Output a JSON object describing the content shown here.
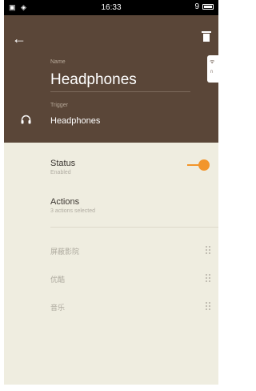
{
  "status_bar": {
    "left_icons": "▣ ◈",
    "time": "16:33",
    "signal": "9"
  },
  "header": {
    "name_label": "Name",
    "name_value": "Headphones",
    "trigger_label": "Trigger",
    "trigger_value": "Headphones",
    "side_tab_icons": [
      "wifi-icon",
      "headphones-icon"
    ]
  },
  "settings": {
    "status_title": "Status",
    "status_subtitle": "Enabled",
    "status_enabled": true,
    "actions_title": "Actions",
    "actions_subtitle": "3 actions selected"
  },
  "actions": [
    {
      "label": "屏蔽影院"
    },
    {
      "label": "优酷"
    },
    {
      "label": "音乐"
    }
  ],
  "colors": {
    "header_bg": "#5a4638",
    "body_bg": "#efede0",
    "accent": "#f2952b"
  }
}
